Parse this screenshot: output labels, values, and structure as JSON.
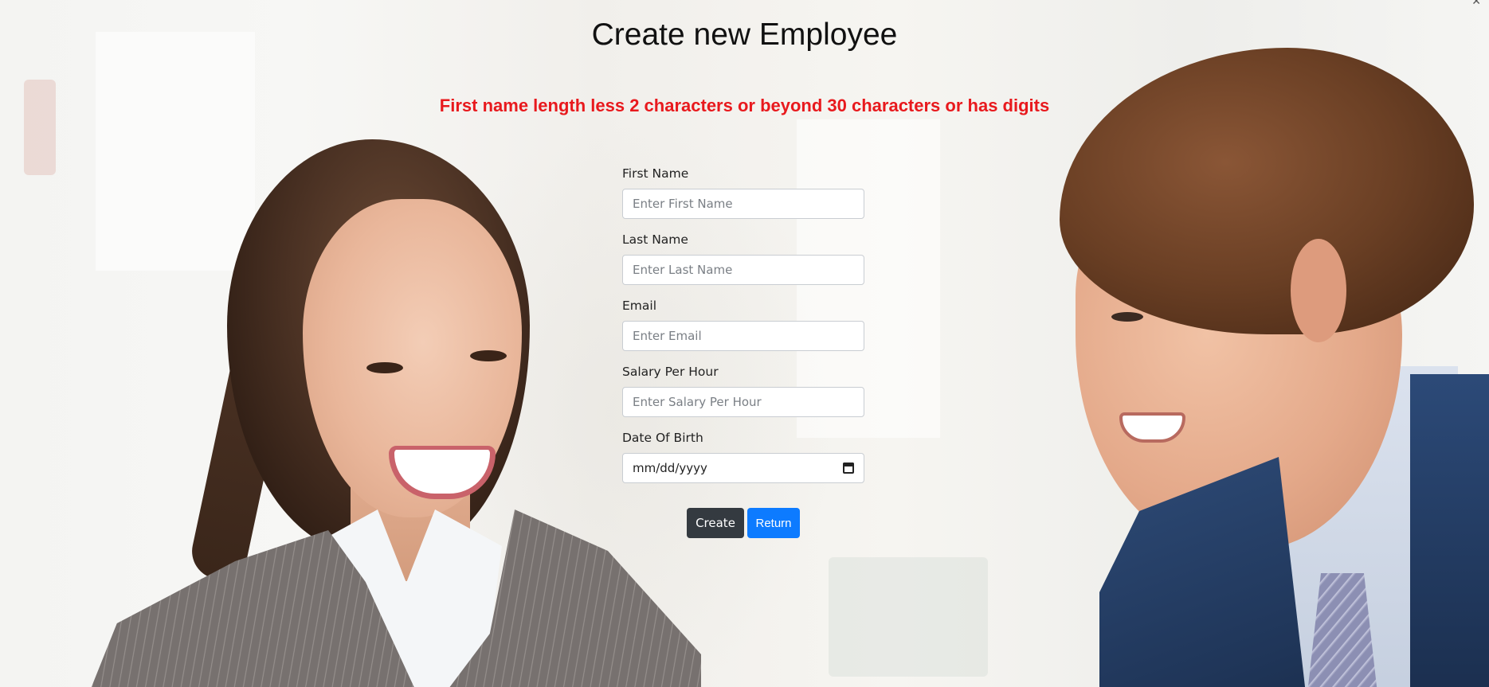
{
  "page": {
    "title": "Create new Employee",
    "error_message": "First name length less 2 characters or beyond 30 characters or has digits"
  },
  "form": {
    "fields": [
      {
        "label": "First Name",
        "placeholder": "Enter First Name",
        "value": ""
      },
      {
        "label": "Last Name",
        "placeholder": "Enter Last Name",
        "value": ""
      },
      {
        "label": "Email",
        "placeholder": "Enter Email",
        "value": ""
      },
      {
        "label": "Salary Per Hour",
        "placeholder": "Enter Salary Per Hour",
        "value": ""
      },
      {
        "label": "Date Of Birth",
        "placeholder": "mm/dd/yyyy",
        "value": "",
        "icon": "calendar-icon"
      }
    ],
    "create_label": "Create",
    "return_label": "Return"
  },
  "colors": {
    "error": "#e8191d",
    "create_button": "#343a40",
    "return_button": "#0d7bff"
  },
  "icons": {
    "corner": "close-icon"
  }
}
